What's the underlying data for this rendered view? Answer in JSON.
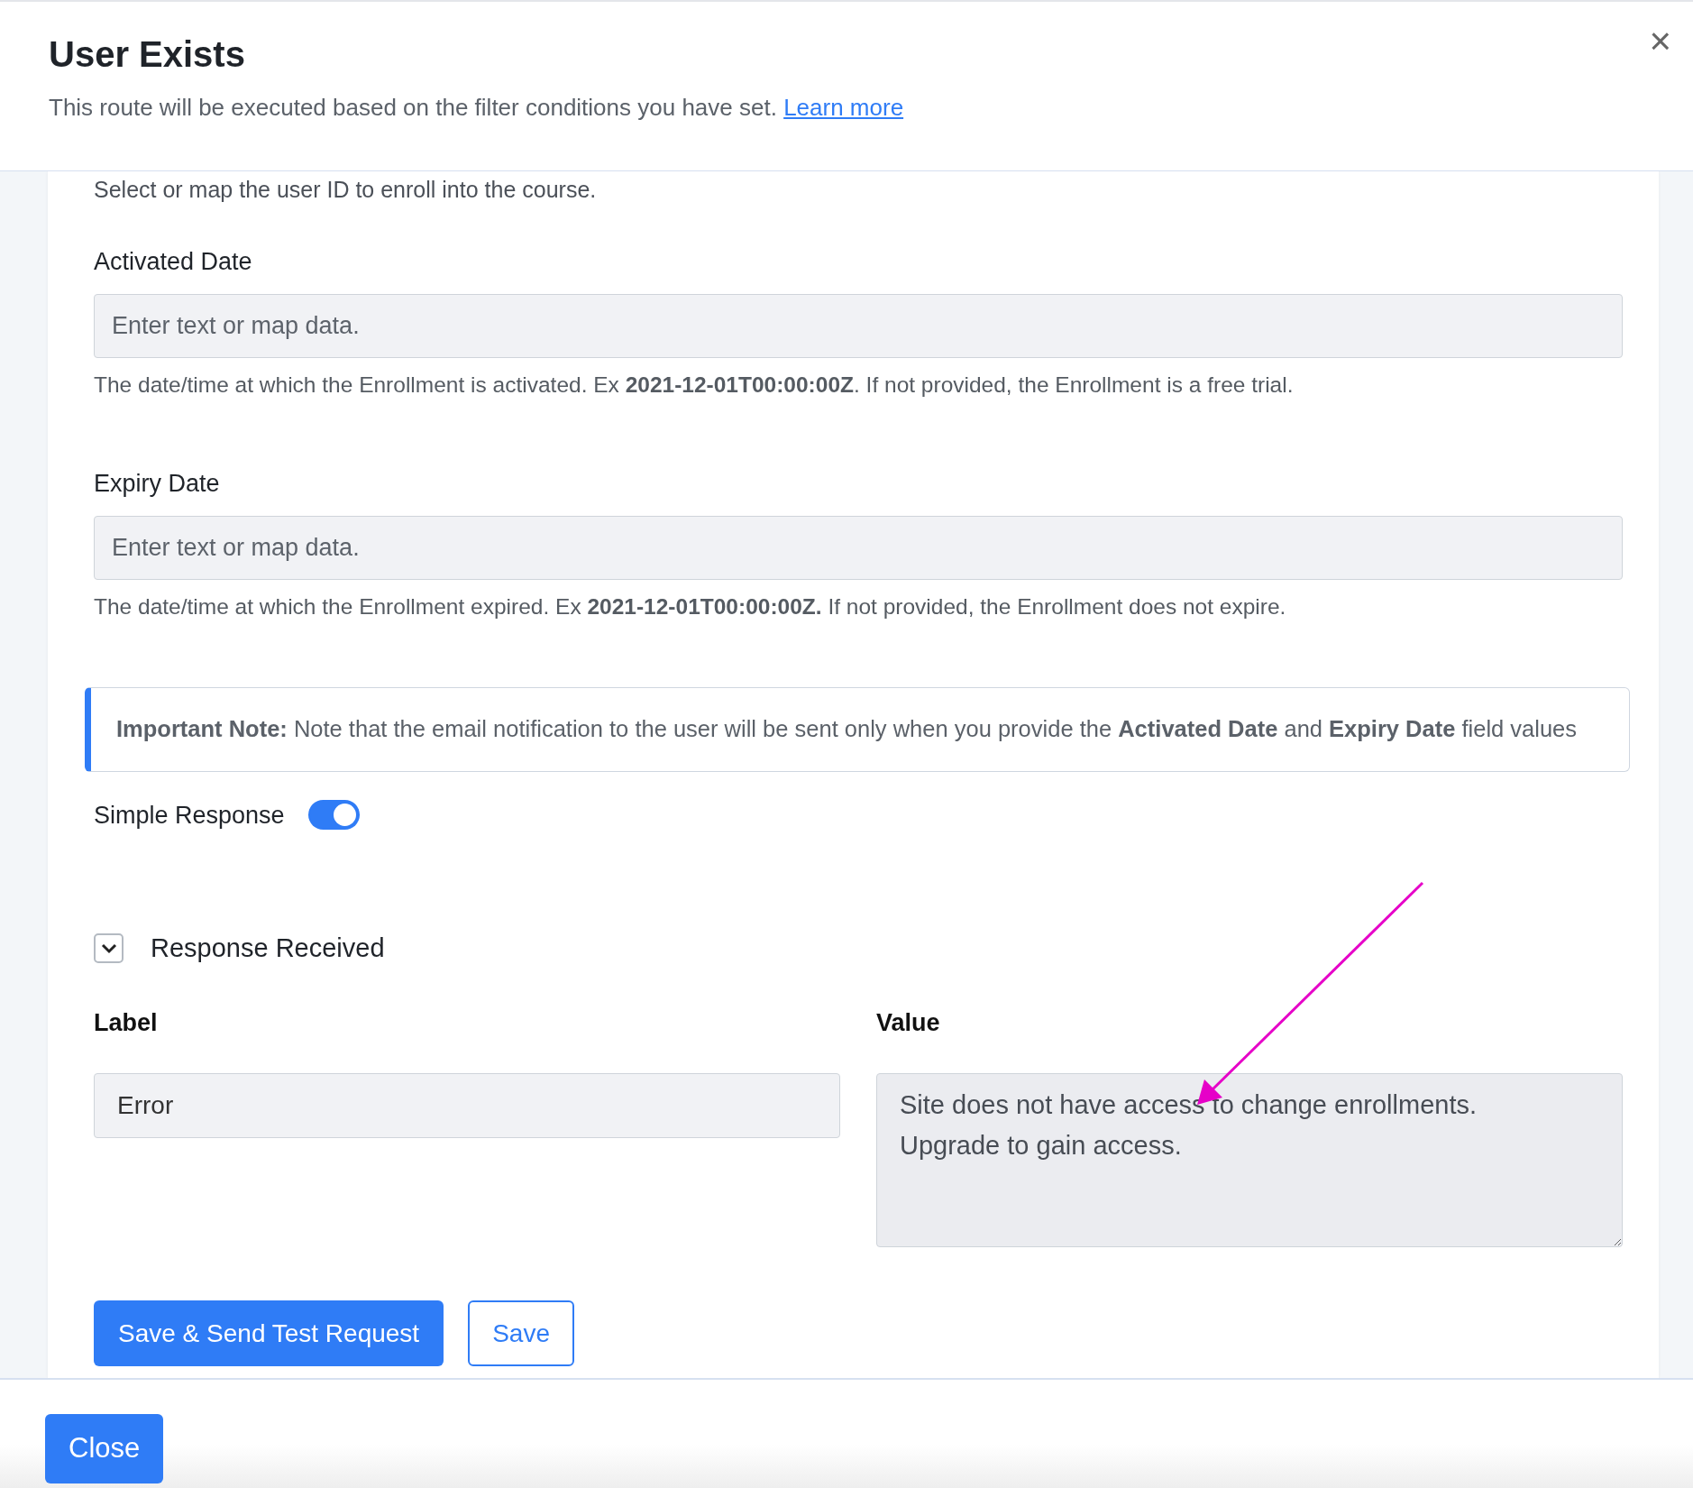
{
  "modal": {
    "title": "User Exists",
    "subtitle": "This route will be executed based on the filter conditions you have set.",
    "subtitle_link": "Learn more",
    "close_icon": "×"
  },
  "form": {
    "cut_hint": "Select or map the user ID to enroll into the course.",
    "fields": [
      {
        "label": "Activated Date",
        "placeholder": "Enter text or map data.",
        "help": "The date/time at which the Enrollment is activated. Ex **2021-12-01T00:00:00Z**. If not provided, the Enrollment is a free trial."
      },
      {
        "label": "Expiry Date",
        "placeholder": "Enter text or map data.",
        "help": "The date/time at which the Enrollment expired. Ex **2021-12-01T00:00:00Z.** If not provided, the Enrollment does not expire."
      }
    ],
    "note": "**Important Note:** Note that the email notification to the user will be sent only when you provide the **Activated Date** and **Expiry Date** field values",
    "simple_response": {
      "label": "Simple Response",
      "on": true
    },
    "response": {
      "title": "Response Received",
      "expanded": true,
      "label_heading": "Label",
      "value_heading": "Value",
      "label_value": "Error",
      "value_value": "Site does not have access to change enrollments.\nUpgrade to gain access."
    },
    "buttons": [
      {
        "label": "Save & Send Test Request",
        "kind": "primary"
      },
      {
        "label": "Save",
        "kind": "outline"
      }
    ]
  },
  "footer": {
    "close_button": "Close"
  }
}
